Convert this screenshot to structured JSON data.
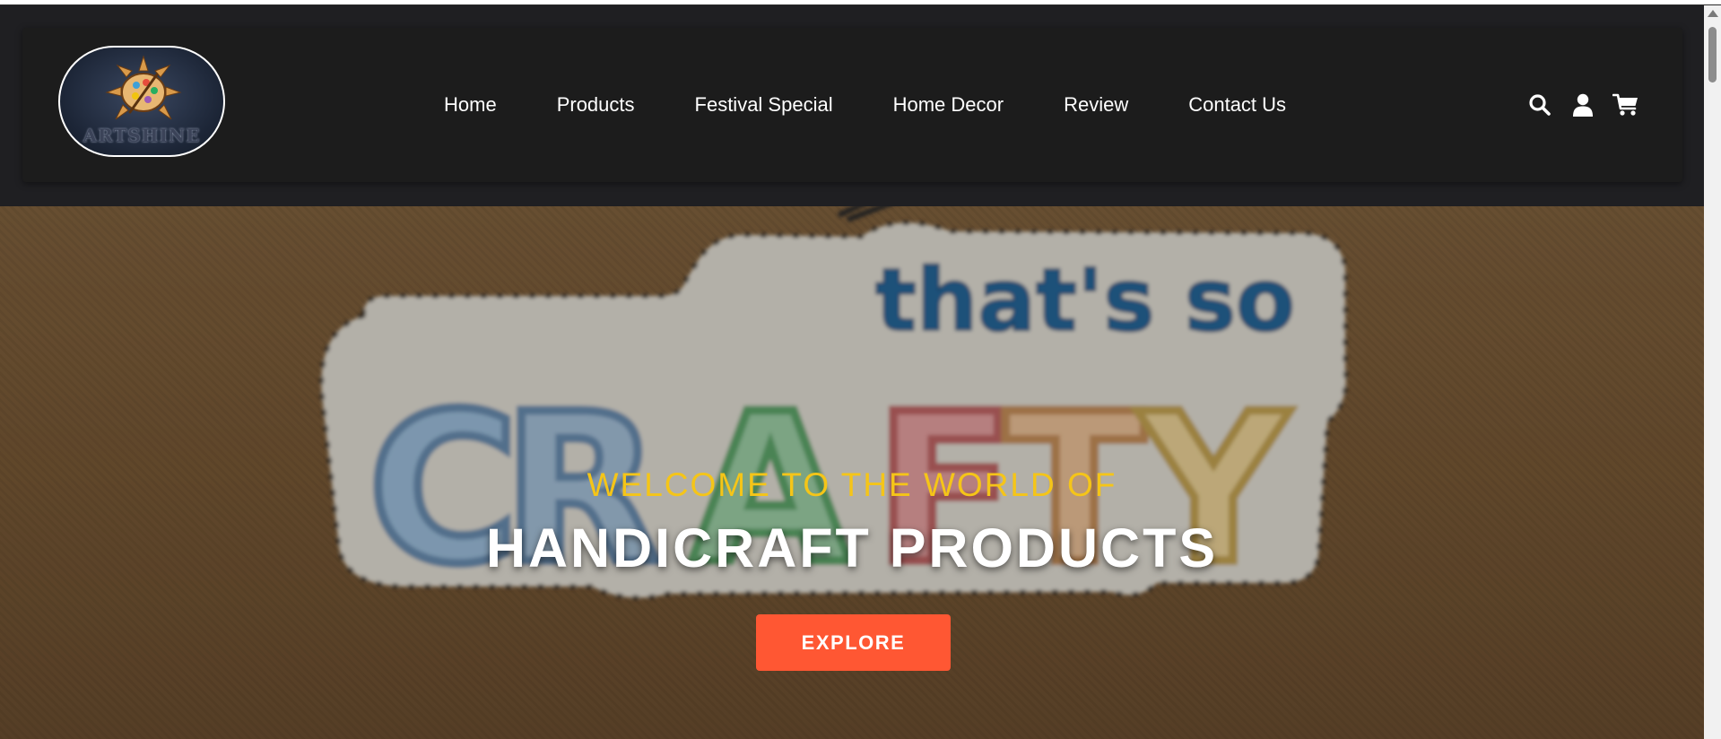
{
  "brand": {
    "logo_text": "ARTSHINE",
    "logo_icon": "palette-sun-icon"
  },
  "nav": {
    "links": [
      {
        "label": "Home"
      },
      {
        "label": "Products"
      },
      {
        "label": "Festival Special"
      },
      {
        "label": "Home Decor"
      },
      {
        "label": "Review"
      },
      {
        "label": "Contact Us"
      }
    ],
    "icons": [
      "search-icon",
      "user-icon",
      "cart-icon"
    ]
  },
  "hero": {
    "background_sign": {
      "line1": "that's so",
      "line2": "CRAFTY"
    },
    "subtitle": "WELCOME TO THE WORLD OF",
    "title": "HANDICRAFT PRODUCTS",
    "button_label": "EXPLORE"
  },
  "colors": {
    "nav_bg": "#1c1c1c",
    "accent_yellow": "#f5c518",
    "button_orange": "#ff5733",
    "hero_brown": "#7b5b37"
  }
}
